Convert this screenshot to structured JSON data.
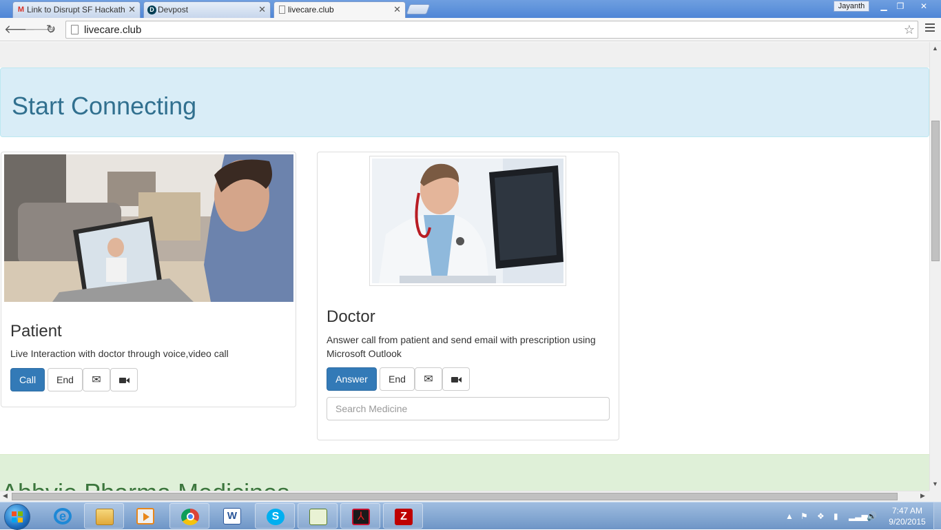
{
  "browser": {
    "tabs": [
      {
        "label": "Link to Disrupt SF Hackath",
        "favicon": "gmail-icon",
        "active": false
      },
      {
        "label": "Devpost",
        "favicon": "devpost-icon",
        "active": false
      },
      {
        "label": "livecare.club",
        "favicon": "page-icon",
        "active": true
      }
    ],
    "profile_name": "Jayanth",
    "address": "livecare.club"
  },
  "page": {
    "jumbotron_title": "Start Connecting",
    "patient": {
      "title": "Patient",
      "description": "Live Interaction with doctor through voice,video call",
      "call_label": "Call",
      "end_label": "End"
    },
    "doctor": {
      "title": "Doctor",
      "description": "Answer call from patient and send email with prescription using Microsoft Outlook",
      "answer_label": "Answer",
      "end_label": "End",
      "search_placeholder": "Search Medicine"
    },
    "next_section_title": "Abbvie Pharma Medicines"
  },
  "taskbar": {
    "apps": [
      "internet-explorer-icon",
      "file-explorer-icon",
      "media-player-icon",
      "chrome-icon",
      "word-icon",
      "skype-icon",
      "notepad-icon",
      "acrobat-icon",
      "filezilla-icon"
    ],
    "time": "7:47 AM",
    "date": "9/20/2015"
  },
  "colors": {
    "primary": "#337ab7",
    "info_bg": "#d9edf7",
    "info_text": "#31708f",
    "success_bg": "#dff0d8",
    "success_text": "#3c763d"
  }
}
